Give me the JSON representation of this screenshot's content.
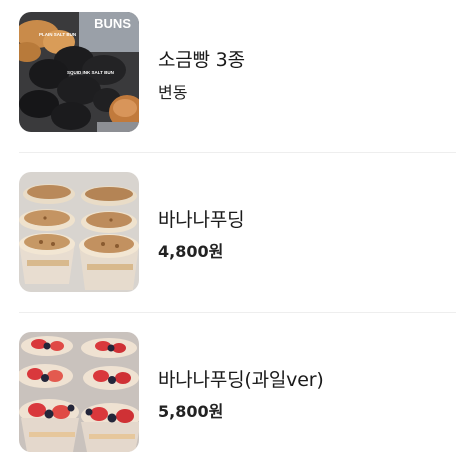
{
  "menu": {
    "items": [
      {
        "name": "소금빵 3종",
        "price": "변동",
        "image": {
          "description_icon": "salt-bread-photo",
          "overlay_title": "BUNS",
          "overlay_label_1": "PLAIN SALT BUN",
          "overlay_label_2": "SQUID INK SALT BUN"
        }
      },
      {
        "name": "바나나푸딩",
        "price": "4,800원",
        "image": {
          "description_icon": "banana-pudding-photo"
        }
      },
      {
        "name": "바나나푸딩(과일ver)",
        "price": "5,800원",
        "image": {
          "description_icon": "fruit-banana-pudding-photo"
        }
      }
    ]
  },
  "colors": {
    "divider": "#eeeeee",
    "text_primary": "#1a1a1a",
    "bun_dark": "#1c1c1e",
    "bun_golden": "#c98b4a",
    "strawberry": "#d9383c",
    "blueberry": "#24263a",
    "pudding_cream": "#efe2cd"
  }
}
